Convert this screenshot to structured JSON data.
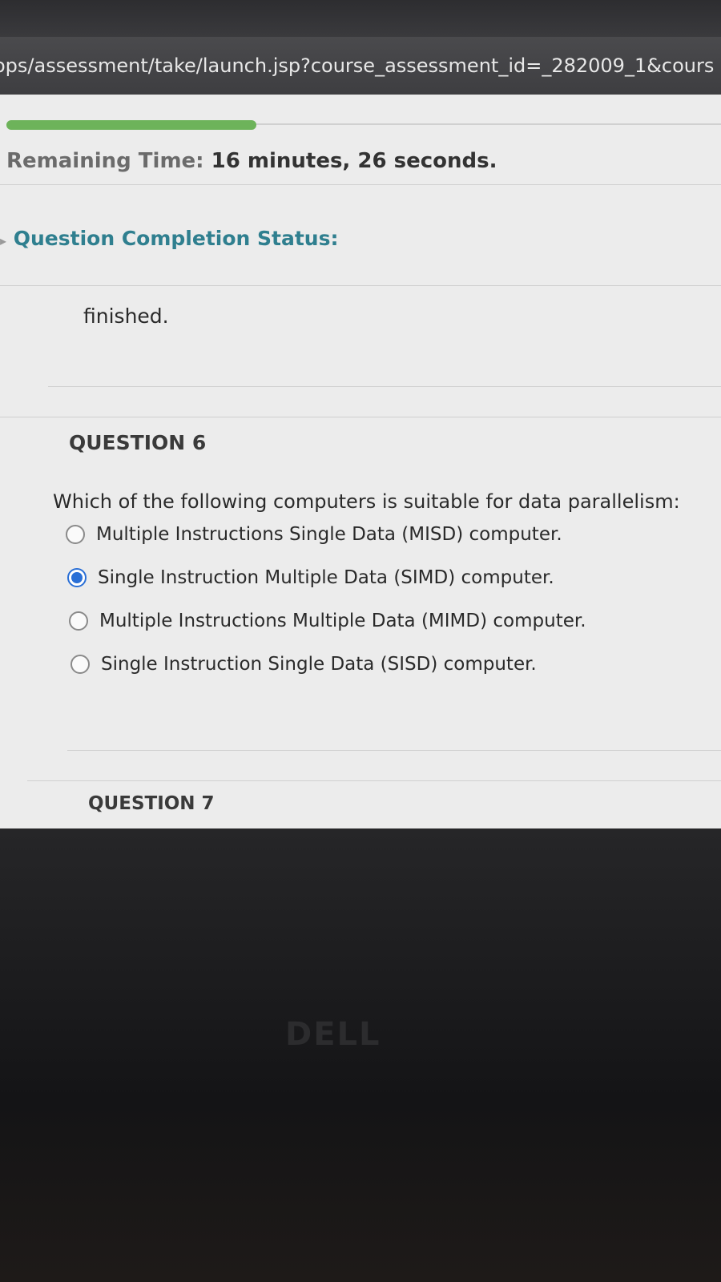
{
  "browser": {
    "url": "ops/assessment/take/launch.jsp?course_assessment_id=_282009_1&cours"
  },
  "progress": {
    "fraction": 0.35
  },
  "timer": {
    "label": "Remaining Time:",
    "value": "16 minutes, 26 seconds."
  },
  "completion_status": {
    "label": "Question Completion Status:"
  },
  "previous_question": {
    "clipped_text": "finished."
  },
  "question6": {
    "title": "QUESTION 6",
    "text": "Which of the following computers is suitable for data parallelism:",
    "options": [
      {
        "label": "Multiple Instructions Single Data (MISD) computer.",
        "selected": false
      },
      {
        "label": "Single Instruction Multiple Data (SIMD) computer.",
        "selected": true
      },
      {
        "label": "Multiple Instructions Multiple Data (MIMD) computer.",
        "selected": false
      },
      {
        "label": "Single Instruction Single Data (SISD) computer.",
        "selected": false
      }
    ]
  },
  "question7": {
    "title": "QUESTION 7"
  },
  "device": {
    "brand": "DELL"
  },
  "colors": {
    "accent": "#2a6fd6",
    "progress": "#6db35a",
    "status_text": "#2f7f8f"
  }
}
